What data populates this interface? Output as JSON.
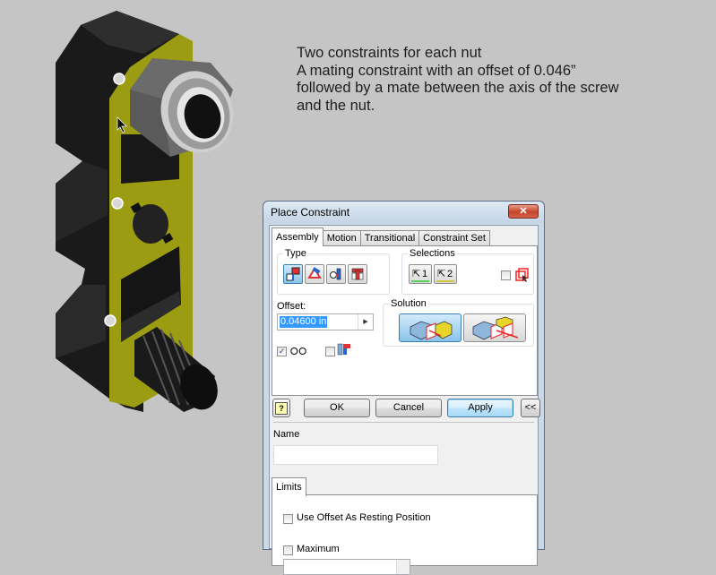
{
  "note": {
    "lines": [
      "Two constraints for each nut",
      "A mating constraint with an offset of 0.046”",
      "followed by a mate between the axis of the screw",
      "and the nut."
    ]
  },
  "model": {
    "description": "3D CAD assembly: black/yellow bracket with hex nut and threaded screw",
    "colors": {
      "body": "#1c1c1c",
      "face": "#9a9a10",
      "nut": "#6e6e6e",
      "background": "#c5c5c5"
    }
  },
  "dialog": {
    "title": "Place Constraint",
    "close_icon": "close-icon",
    "tabs": [
      {
        "label": "Assembly",
        "active": true
      },
      {
        "label": "Motion",
        "active": false
      },
      {
        "label": "Transitional",
        "active": false
      },
      {
        "label": "Constraint Set",
        "active": false
      }
    ],
    "type_group": {
      "label": "Type",
      "buttons": [
        {
          "name": "mate-constraint",
          "icon": "mate-icon",
          "selected": true
        },
        {
          "name": "angle-constraint",
          "icon": "angle-icon",
          "selected": false
        },
        {
          "name": "tangent-constraint",
          "icon": "tangent-icon",
          "selected": false
        },
        {
          "name": "insert-constraint",
          "icon": "insert-icon",
          "selected": false
        }
      ]
    },
    "selections_group": {
      "label": "Selections",
      "buttons": [
        {
          "label": "1",
          "icon": "select-arrow-icon",
          "underline_color": "#5bd15b"
        },
        {
          "label": "2",
          "icon": "select-arrow-icon",
          "underline_color": "#d1c23a"
        }
      ],
      "pick_part_first_checked": false
    },
    "offset": {
      "label": "Offset:",
      "value": "0.04600 in"
    },
    "show_preview_checked": true,
    "predict_offset_checked": false,
    "solution_group": {
      "label": "Solution",
      "options": [
        {
          "name": "mate",
          "selected": true
        },
        {
          "name": "flush",
          "selected": false
        }
      ]
    },
    "buttons": {
      "help": "?",
      "ok": "OK",
      "cancel": "Cancel",
      "apply": "Apply",
      "collapse": "<<"
    },
    "name": {
      "label": "Name",
      "value": ""
    },
    "limits": {
      "tab_label": "Limits",
      "use_offset_label": "Use Offset As Resting Position",
      "use_offset_checked": false,
      "maximum_label": "Maximum",
      "maximum_checked": false
    }
  }
}
